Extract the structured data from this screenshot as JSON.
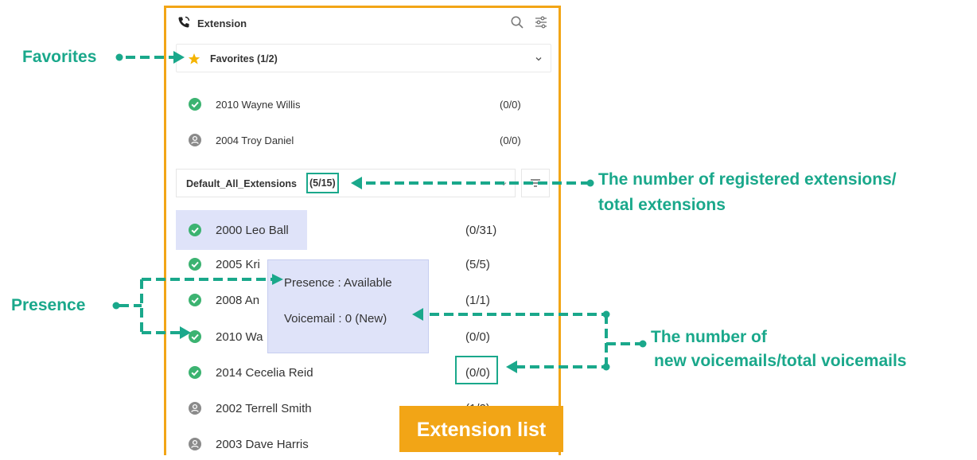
{
  "colors": {
    "accent_orange": "#f2a516",
    "annotation_green": "#1aa88b",
    "available_green": "#3cb371",
    "offline_gray": "#8a8a8a",
    "highlight": "#dfe3f9"
  },
  "header": {
    "title": "Extension",
    "icons": [
      "phone-icon",
      "search-icon",
      "filter-settings-icon"
    ]
  },
  "favorites": {
    "label": "Favorites (1/2)",
    "items": [
      {
        "name": "2010 Wayne Willis",
        "count": "(0/0)",
        "status": "available"
      },
      {
        "name": "2004 Troy Daniel",
        "count": "(0/0)",
        "status": "offline"
      }
    ]
  },
  "group": {
    "name": "Default_All_Extensions",
    "count": "(5/15)"
  },
  "extensions": [
    {
      "name": "2000 Leo Ball",
      "count": "(0/31)",
      "status": "available"
    },
    {
      "name": "2005 Kri",
      "count": "(5/5)",
      "status": "available"
    },
    {
      "name": "2008 An",
      "count": "(1/1)",
      "status": "available"
    },
    {
      "name": "2010 Wa",
      "count": "(0/0)",
      "status": "available"
    },
    {
      "name": "2014 Cecelia Reid",
      "count": "(0/0)",
      "status": "available"
    },
    {
      "name": "2002 Terrell Smith",
      "count": "(1/2)",
      "status": "offline"
    },
    {
      "name": "2003 Dave Harris",
      "count": "",
      "status": "offline"
    }
  ],
  "tooltip": {
    "presence": "Presence : Available",
    "voicemail": "Voicemail : 0 (New)"
  },
  "badge": "Extension list",
  "annotations": {
    "favorites": "Favorites",
    "presence": "Presence",
    "registered_line1": "The number of registered extensions/",
    "registered_line2": "total extensions",
    "voicemail_line1": "The number of",
    "voicemail_line2": "new voicemails/total voicemails"
  }
}
